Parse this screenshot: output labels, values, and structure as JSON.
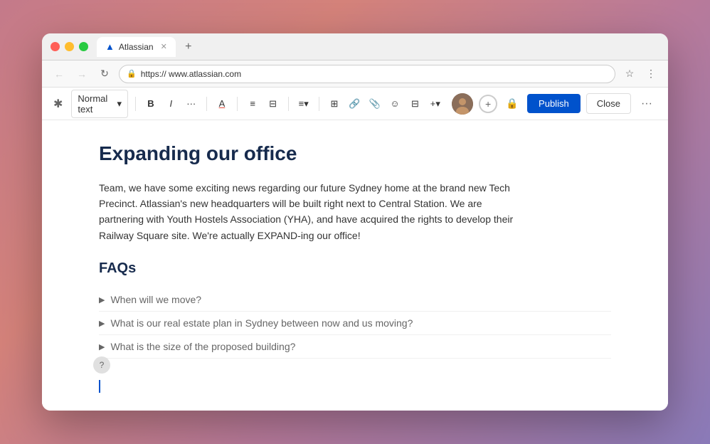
{
  "browser": {
    "traffic_lights": [
      "close",
      "minimize",
      "maximize"
    ],
    "tab": {
      "logo": "A",
      "title": "Atlassian"
    },
    "tab_add_label": "+",
    "address": {
      "url": "https://  www.atlassian.com",
      "lock_symbol": "🔒"
    }
  },
  "toolbar": {
    "logo_symbol": "✕",
    "style_dropdown": "Normal text",
    "chevron_down": "▾",
    "bold": "B",
    "italic": "I",
    "more_format": "···",
    "text_color": "A",
    "bullet_list": "☰",
    "numbered_list": "≡",
    "align": "≡",
    "table": "⊞",
    "link": "🔗",
    "attachment": "📎",
    "emoji": "☺",
    "columns": "⊟",
    "insert_more": "+",
    "publish_label": "Publish",
    "close_label": "Close",
    "more_dots": "···"
  },
  "editor": {
    "title": "Expanding our office",
    "body_text": "Team, we have some exciting news regarding our future Sydney home at the brand new Tech Precinct. Atlassian's new headquarters will be built right next to Central Station. We are partnering with Youth Hostels Association (YHA), and have acquired the rights to develop their Railway Square site. We're actually EXPAND-ing our office!",
    "faqs_heading": "FAQs",
    "faqs": [
      {
        "question": "When will we move?"
      },
      {
        "question": "What is our real estate plan in Sydney between now and us moving?"
      },
      {
        "question": "What is the size of the proposed building?"
      }
    ]
  },
  "help_label": "?"
}
